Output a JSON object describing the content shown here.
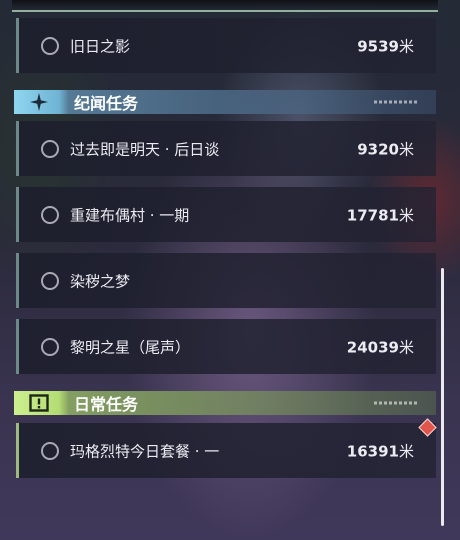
{
  "colors": {
    "story_header_accent": "#8fd6f0",
    "daily_header_accent": "#cdef8e",
    "row_border_story": "#6d8a88",
    "row_border_daily": "#9dbb7e",
    "badge": "#e0564c"
  },
  "quests_top": [
    {
      "name": "旧日之影",
      "distance": "9539",
      "unit": "米"
    }
  ],
  "sections": {
    "story": {
      "title": "纪闻任务",
      "icon": "sparkle-icon",
      "items": [
        {
          "name": "过去即是明天 · 后日谈",
          "distance": "9320",
          "unit": "米"
        },
        {
          "name": "重建布偶村 · 一期",
          "distance": "17781",
          "unit": "米"
        },
        {
          "name": "染秽之梦",
          "distance": "",
          "unit": ""
        },
        {
          "name": "黎明之星（尾声）",
          "distance": "24039",
          "unit": "米"
        }
      ]
    },
    "daily": {
      "title": "日常任务",
      "icon": "exclamation-box-icon",
      "items": [
        {
          "name": "玛格烈特今日套餐 · 一",
          "distance": "16391",
          "unit": "米",
          "badge": "new-indicator-icon"
        }
      ]
    }
  }
}
